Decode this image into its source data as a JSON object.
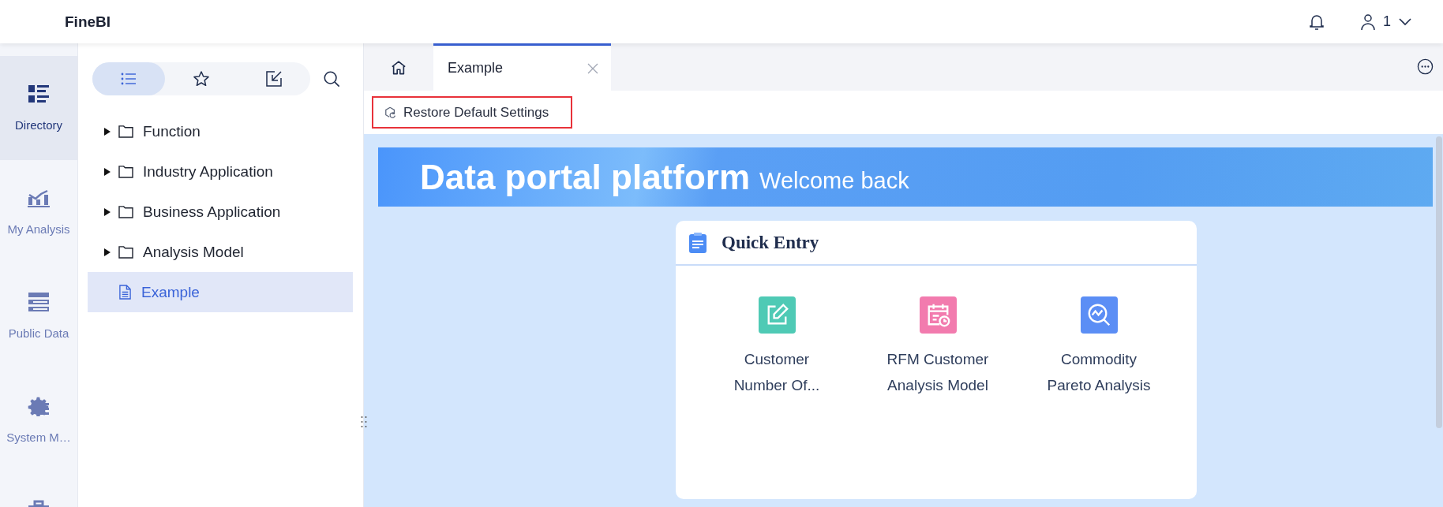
{
  "app": {
    "title": "FineBI"
  },
  "header": {
    "user": "1"
  },
  "rail": [
    {
      "label": "Directory",
      "selected": true
    },
    {
      "label": "My Analysis",
      "selected": false
    },
    {
      "label": "Public Data",
      "selected": false
    },
    {
      "label": "System M…",
      "selected": false
    },
    {
      "selected": false
    }
  ],
  "panel_tabs": [
    {
      "selected": true
    },
    {
      "selected": false
    },
    {
      "selected": false
    }
  ],
  "tree": [
    {
      "label": "Function",
      "kind": "folder",
      "expanded": false,
      "selected": false
    },
    {
      "label": "Industry Application",
      "kind": "folder",
      "expanded": false,
      "selected": false
    },
    {
      "label": "Business Application",
      "kind": "folder",
      "expanded": false,
      "selected": false
    },
    {
      "label": "Analysis Model",
      "kind": "folder",
      "expanded": false,
      "selected": false
    },
    {
      "label": "Example",
      "kind": "report",
      "selected": true
    }
  ],
  "tabs": [
    {
      "kind": "home",
      "selected": false
    },
    {
      "kind": "page",
      "label": "Example",
      "selected": true
    }
  ],
  "toolbar": {
    "restore_button": "Restore Default Settings",
    "highlighted": true
  },
  "banner": {
    "title": "Data portal platform",
    "subtitle": "Welcome back"
  },
  "quick_entry": {
    "title": "Quick Entry",
    "items": [
      {
        "label": "Customer Number Of...",
        "color": "#4fcab5"
      },
      {
        "label": "RFM Customer Analysis Model",
        "color": "#f27bae"
      },
      {
        "label": "Commodity Pareto Analysis",
        "color": "#5b8ef5"
      }
    ]
  }
}
